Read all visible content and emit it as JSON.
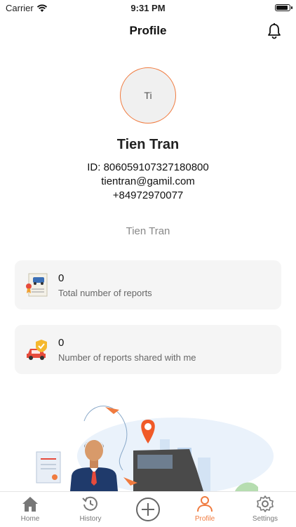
{
  "status_bar": {
    "carrier": "Carrier",
    "time": "9:31 PM"
  },
  "header": {
    "title": "Profile"
  },
  "profile": {
    "avatar_initials": "Ti",
    "name": "Tien Tran",
    "id_line": "ID: 806059107327180800",
    "email": "tientran@gamil.com",
    "phone": "+84972970077",
    "display_name": "Tien Tran"
  },
  "stats": [
    {
      "count": "0",
      "label": "Total number of reports",
      "icon": "certificate-car-icon"
    },
    {
      "count": "0",
      "label": "Number of reports shared with me",
      "icon": "insured-car-icon"
    }
  ],
  "tabs": [
    {
      "label": "Home",
      "icon": "home-icon"
    },
    {
      "label": "History",
      "icon": "history-icon"
    },
    {
      "label": "",
      "icon": "add-circle-icon"
    },
    {
      "label": "Profile",
      "icon": "profile-icon",
      "active": true
    },
    {
      "label": "Settings",
      "icon": "settings-icon"
    }
  ],
  "colors": {
    "accent": "#f07b3f",
    "card_bg": "#f5f5f5"
  }
}
